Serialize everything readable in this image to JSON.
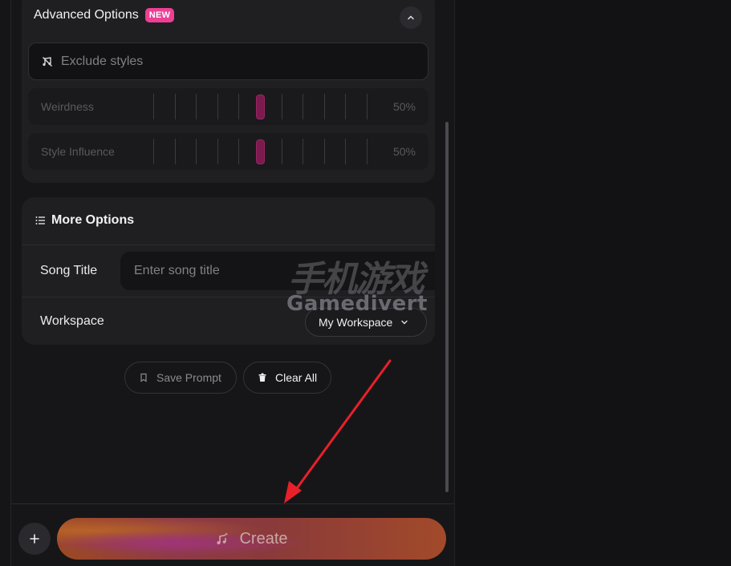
{
  "advanced": {
    "title": "Advanced Options",
    "badge": "NEW",
    "exclude_placeholder": "Exclude styles",
    "sliders": [
      {
        "label": "Weirdness",
        "value_text": "50%",
        "value": 0.5
      },
      {
        "label": "Style Influence",
        "value_text": "50%",
        "value": 0.5
      }
    ]
  },
  "more": {
    "title": "More Options",
    "song_title_label": "Song Title",
    "song_title_placeholder": "Enter song title",
    "workspace_label": "Workspace",
    "workspace_value": "My Workspace"
  },
  "actions": {
    "save_prompt": "Save Prompt",
    "clear_all": "Clear All"
  },
  "bottom": {
    "create_label": "Create"
  },
  "watermark": {
    "chinese": "手机游戏",
    "english": "Gamedivert"
  },
  "colors": {
    "accent": "#ec3f95",
    "slider_thumb": "#7a1a4d",
    "annotation_arrow": "#e8202a"
  },
  "icons": {
    "exclude": "music-slash-icon",
    "collapse": "chevron-up-icon",
    "more_options": "list-icon",
    "workspace_dropdown": "chevron-down-icon",
    "save": "bookmark-icon",
    "clear": "trash-icon",
    "add": "plus-icon",
    "create": "music-sparkle-icon"
  }
}
